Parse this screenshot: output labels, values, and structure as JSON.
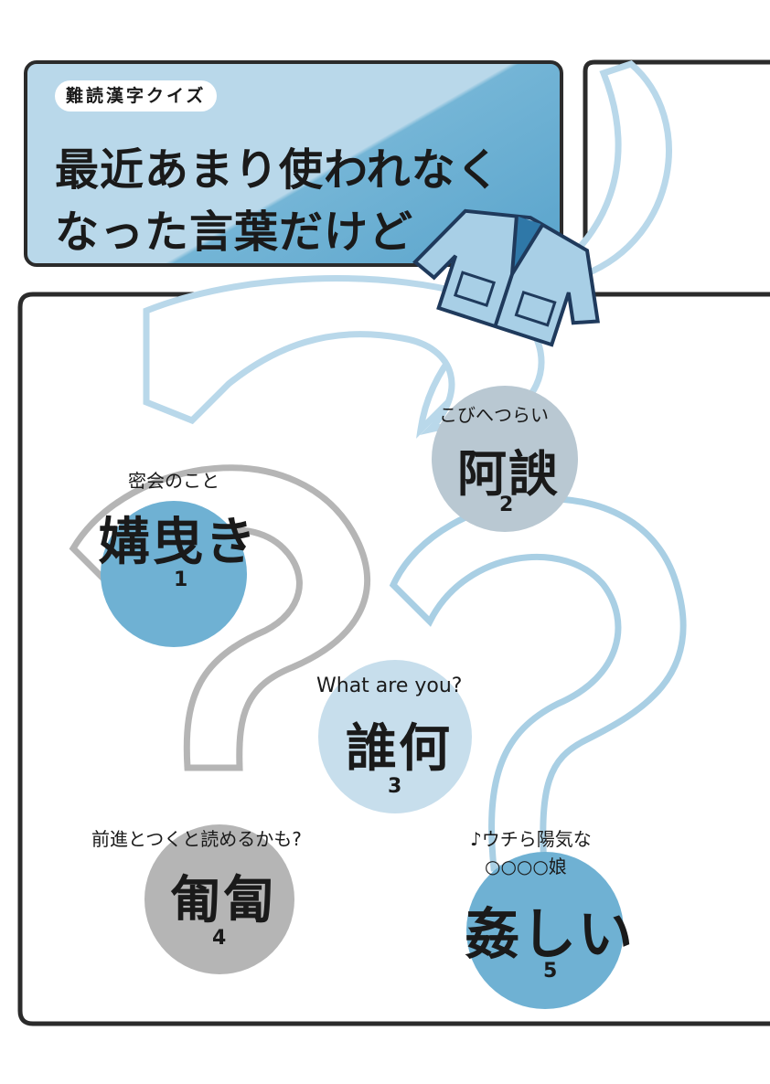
{
  "header": {
    "badge": "難読漢字クイズ",
    "title_line1": "最近あまり使われなく",
    "title_line2": "なった言葉だけど"
  },
  "quiz": [
    {
      "hint": "密会のこと",
      "word": "媾曳き",
      "number": "1"
    },
    {
      "hint": "こびへつらい",
      "word": "阿諛",
      "number": "2"
    },
    {
      "hint": "What are you?",
      "word": "誰何",
      "number": "3"
    },
    {
      "hint": "前進とつくと読めるかも?",
      "word": "匍匐",
      "number": "4"
    },
    {
      "hint_line1": "♪ウチら陽気な",
      "hint_line2": "○○○○娘",
      "word": "姦しい",
      "number": "5"
    }
  ],
  "colors": {
    "light_blue": "#b9d8ea",
    "mid_blue": "#6fb1d3",
    "gray": "#b5b5b5",
    "frame": "#2b2b2b"
  },
  "icons": [
    "question-mark-decoration",
    "happi-coat-illustration"
  ]
}
